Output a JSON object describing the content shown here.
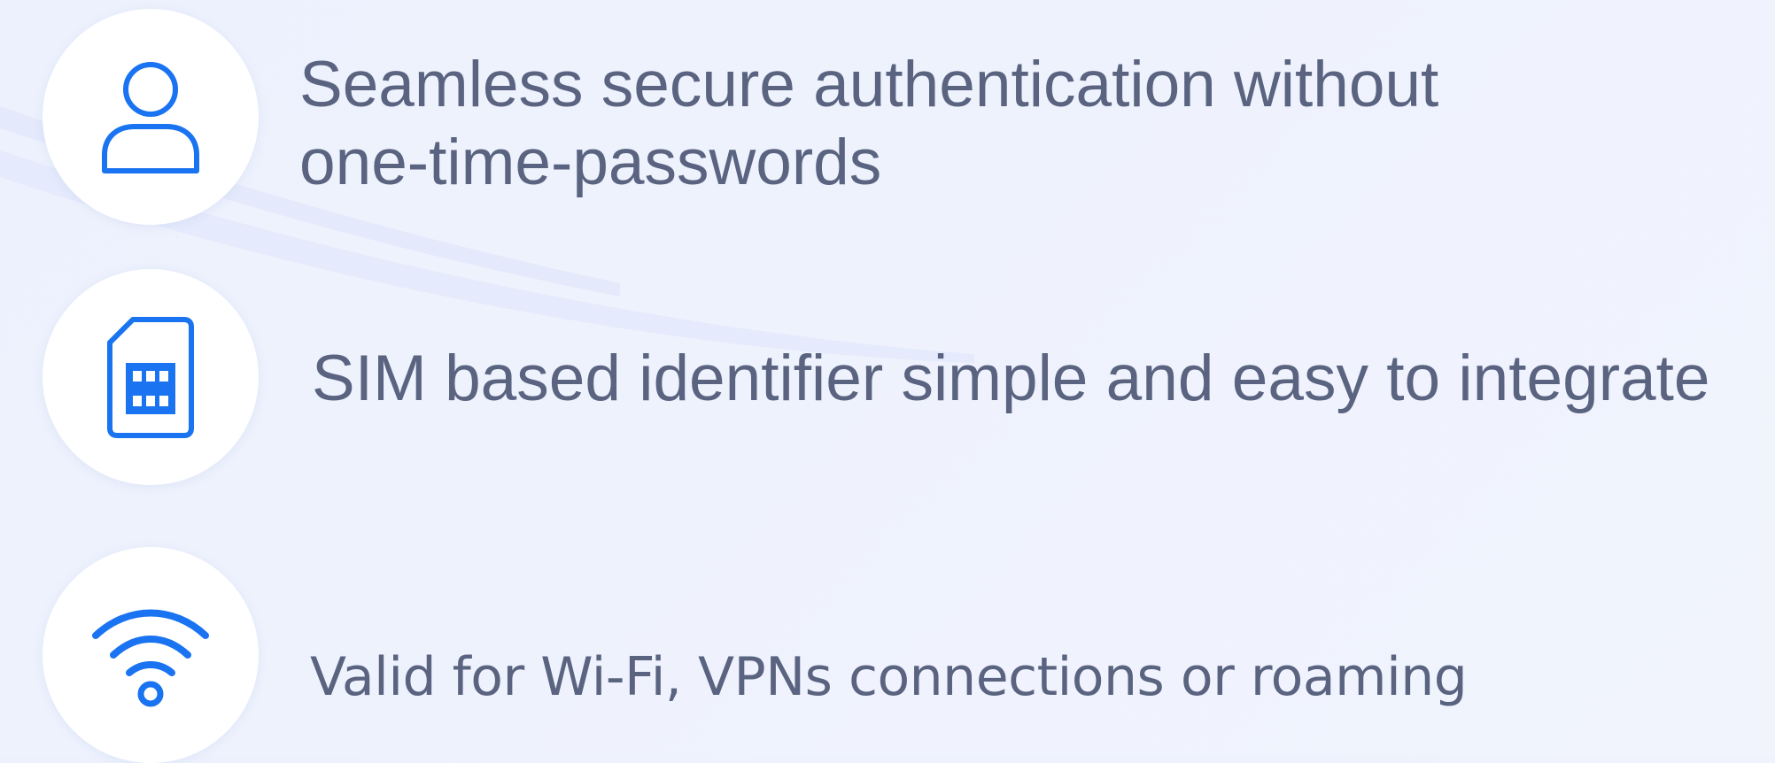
{
  "features": [
    {
      "icon": "user-icon",
      "lines": [
        "Seamless secure authentication without",
        "one-time-passwords"
      ]
    },
    {
      "icon": "sim-card-icon",
      "text": "SIM based identifier simple and easy to integrate"
    },
    {
      "icon": "wifi-icon",
      "text": "Valid for Wi-Fi, VPNs connections or roaming"
    }
  ],
  "colors": {
    "background": "#eef2fd",
    "icon_blue": "#1a73f0",
    "text": "#5a6480",
    "circle": "#ffffff"
  }
}
